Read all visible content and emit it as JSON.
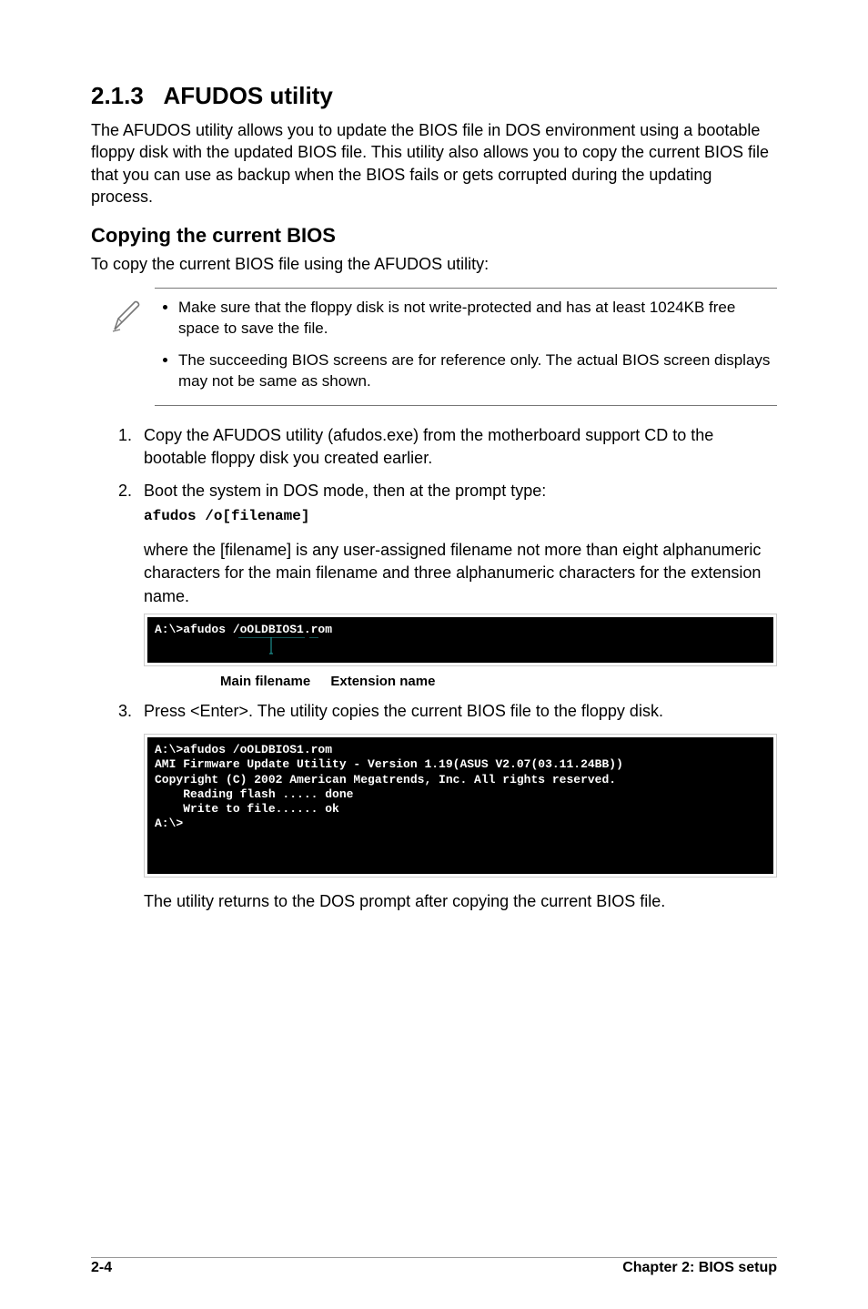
{
  "section": {
    "number": "2.1.3",
    "title": "AFUDOS utility",
    "intro": "The AFUDOS utility allows you to update the BIOS file in DOS environment using a bootable floppy disk with the updated BIOS file. This utility also allows you to copy the current BIOS file that you can use as backup when the BIOS fails or gets corrupted during the updating process."
  },
  "sub": {
    "title": "Copying the current BIOS",
    "intro": "To copy the current BIOS file using the AFUDOS utility:"
  },
  "note": {
    "icon_name": "pen-icon",
    "bullets": [
      "Make sure that the floppy disk is not write-protected and has at least 1024KB free space to save the file.",
      "The succeeding BIOS screens are for reference only. The actual BIOS screen displays may not be same as shown."
    ]
  },
  "steps": {
    "s1": "Copy the AFUDOS utility (afudos.exe) from the motherboard support CD to the bootable floppy disk you created earlier.",
    "s2": "Boot the system in DOS mode, then at the prompt type:",
    "s2_cmd": "afudos /o[filename]",
    "s2_desc": "where the [filename] is any user-assigned filename not more than eight alphanumeric characters  for the main filename and three alphanumeric characters for the extension name.",
    "terminal1_line1": "A:\\>afudos /oOLDBIOS1.rom",
    "annot_main": "Main filename",
    "annot_ext": "Extension name",
    "s3": "Press <Enter>. The utility copies the current BIOS file to the floppy disk.",
    "terminal2": "A:\\>afudos /oOLDBIOS1.rom\nAMI Firmware Update Utility - Version 1.19(ASUS V2.07(03.11.24BB))\nCopyright (C) 2002 American Megatrends, Inc. All rights reserved.\n    Reading flash ..... done\n    Write to file...... ok\nA:\\>",
    "s3_after": "The utility returns to the DOS prompt after copying the current BIOS file."
  },
  "footer": {
    "left": "2-4",
    "right": "Chapter 2: BIOS setup"
  }
}
